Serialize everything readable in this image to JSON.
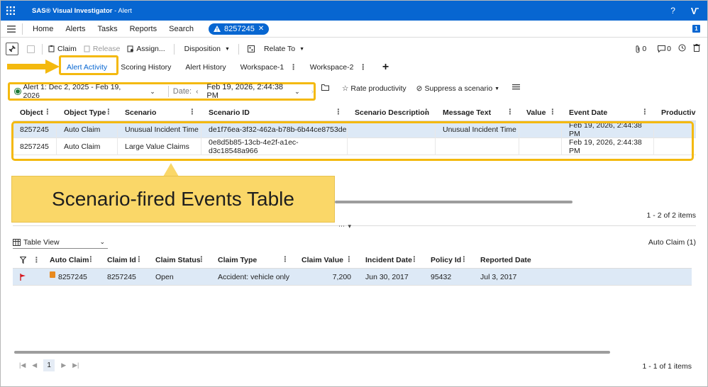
{
  "app": {
    "title": "SAS® Visual Investigator",
    "separator": " - ",
    "subtitle": "Alert",
    "help": "?",
    "brand_glyph": "V"
  },
  "nav": {
    "items": [
      "Home",
      "Alerts",
      "Tasks",
      "Reports",
      "Search"
    ],
    "alert_pill": "8257245",
    "badge": "1"
  },
  "toolbar": {
    "claim": "Claim",
    "release": "Release",
    "assign": "Assign...",
    "disposition": "Disposition",
    "relate_to": "Relate To",
    "attachments_count": "0",
    "comments_count": "0"
  },
  "tabs": [
    {
      "label": "Alert Activity",
      "active": true
    },
    {
      "label": "Scoring History"
    },
    {
      "label": "Alert History"
    },
    {
      "label": "Workspace-1"
    },
    {
      "label": "Workspace-2"
    }
  ],
  "filter": {
    "alert_range": "Alert 1: Dec 2, 2025 - Feb 19, 2026",
    "date_label": "Date:",
    "date_value": "Feb 19, 2026, 2:44:38 PM",
    "rate_productivity": "Rate productivity",
    "suppress": "Suppress a scenario"
  },
  "events_table": {
    "columns": [
      "Object",
      "Object Type",
      "Scenario",
      "Scenario ID",
      "Scenario Description",
      "Message Text",
      "Value",
      "Event Date",
      "Productiv"
    ],
    "rows": [
      [
        "8257245",
        "Auto Claim",
        "Unusual Incident Time",
        "de1f76ea-3f32-462a-b78b-6b44ce8753de",
        "",
        "Unusual Incident Time",
        "",
        "Feb 19, 2026, 2:44:38 PM",
        ""
      ],
      [
        "8257245",
        "Auto Claim",
        "Large Value Claims",
        "0e8d5b85-13cb-4e2f-a1ec-d3c18548a966",
        "",
        "",
        "",
        "Feb 19, 2026, 2:44:38 PM",
        ""
      ]
    ],
    "count": "1 - 2 of 2 items"
  },
  "callout": "Scenario-fired Events Table",
  "lower": {
    "view": "Table View",
    "object_type": "Auto Claim (1)",
    "columns": [
      "Auto Claim",
      "Claim Id",
      "Claim Status",
      "Claim Type",
      "Claim Value",
      "Incident Date",
      "Policy Id",
      "Reported Date"
    ],
    "rows": [
      [
        "8257245",
        "8257245",
        "Open",
        "Accident: vehicle only",
        "7,200",
        "Jun 30, 2017",
        "95432",
        "Jul 3, 2017"
      ]
    ],
    "page": "1",
    "count": "1 - 1 of 1 items"
  },
  "colors": {
    "brand_blue": "#0766d1",
    "highlight_yellow": "#f4b90e",
    "callout_fill": "#fad768",
    "selected_row": "#dde9f6"
  }
}
